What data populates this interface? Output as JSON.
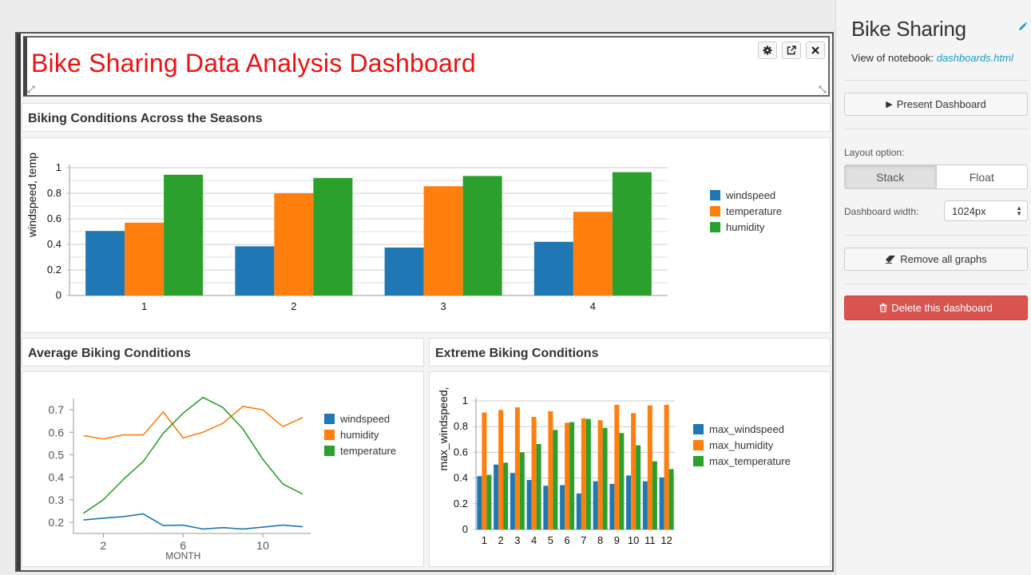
{
  "dashboard": {
    "title": "Bike Sharing Data Analysis Dashboard",
    "title_color": "#ee1111"
  },
  "panels": {
    "seasons_title": "Biking Conditions Across the Seasons",
    "average_title": "Average Biking Conditions",
    "extreme_title": "Extreme Biking Conditions"
  },
  "cell_buttons": {
    "settings_icon": "gear-icon",
    "popout_icon": "external-link-icon",
    "close_icon": "close-icon"
  },
  "sidebar": {
    "title": "Bike Sharing",
    "notebook_label": "View of notebook:",
    "notebook_link": "dashboards.html",
    "present_label": "Present Dashboard",
    "layout_label": "Layout option:",
    "layout_options": [
      "Stack",
      "Float"
    ],
    "layout_selected": "Stack",
    "width_label": "Dashboard width:",
    "width_value": "1024px",
    "remove_label": "Remove all graphs",
    "delete_label": "Delete this dashboard",
    "delete_color": "#d9534f",
    "link_color": "#1aa0c8"
  },
  "chart_data": [
    {
      "type": "bar",
      "categories": [
        "1",
        "2",
        "3",
        "4"
      ],
      "ylabel": "windspeed, temp",
      "ylim": [
        0,
        1
      ],
      "yticks": [
        "0",
        "0.2",
        "0.4",
        "0.6",
        "0.8",
        "1"
      ],
      "legend": "right",
      "series": [
        {
          "name": "windspeed",
          "color": "#1f77b4",
          "values": [
            0.505,
            0.385,
            0.375,
            0.42
          ]
        },
        {
          "name": "temperature",
          "color": "#ff7f0e",
          "values": [
            0.57,
            0.8,
            0.855,
            0.655
          ]
        },
        {
          "name": "humidity",
          "color": "#2ca02c",
          "values": [
            0.945,
            0.92,
            0.935,
            0.965
          ]
        }
      ]
    },
    {
      "type": "line",
      "x": [
        1,
        2,
        3,
        4,
        5,
        6,
        7,
        8,
        9,
        10,
        11,
        12
      ],
      "xlabel": "MONTH",
      "xticks": [
        "2",
        "6",
        "10"
      ],
      "ylim": [
        0.15,
        0.75
      ],
      "yticks": [
        "0.2",
        "0.3",
        "0.4",
        "0.5",
        "0.6",
        "0.7"
      ],
      "legend": "right",
      "series": [
        {
          "name": "windspeed",
          "color": "#1f77b4",
          "values": [
            0.21,
            0.218,
            0.225,
            0.237,
            0.185,
            0.187,
            0.17,
            0.176,
            0.17,
            0.178,
            0.187,
            0.18
          ]
        },
        {
          "name": "humidity",
          "color": "#ff7f0e",
          "values": [
            0.585,
            0.57,
            0.588,
            0.588,
            0.69,
            0.575,
            0.6,
            0.64,
            0.715,
            0.7,
            0.625,
            0.665
          ]
        },
        {
          "name": "temperature",
          "color": "#2ca02c",
          "values": [
            0.24,
            0.3,
            0.39,
            0.47,
            0.595,
            0.685,
            0.755,
            0.71,
            0.615,
            0.48,
            0.37,
            0.325
          ]
        }
      ]
    },
    {
      "type": "bar",
      "categories": [
        "1",
        "2",
        "3",
        "4",
        "5",
        "6",
        "7",
        "8",
        "9",
        "10",
        "11",
        "12"
      ],
      "ylabel": "max_windspeed,",
      "ylim": [
        0,
        1
      ],
      "yticks": [
        "0",
        "0.2",
        "0.4",
        "0.6",
        "0.8",
        "1"
      ],
      "legend": "right",
      "series": [
        {
          "name": "max_windspeed",
          "color": "#1f77b4",
          "values": [
            0.415,
            0.505,
            0.44,
            0.385,
            0.34,
            0.345,
            0.28,
            0.375,
            0.355,
            0.42,
            0.375,
            0.405
          ]
        },
        {
          "name": "max_humidity",
          "color": "#ff7f0e",
          "values": [
            0.91,
            0.93,
            0.95,
            0.875,
            0.92,
            0.83,
            0.865,
            0.85,
            0.97,
            0.905,
            0.965,
            0.97
          ]
        },
        {
          "name": "max_temperature",
          "color": "#2ca02c",
          "values": [
            0.425,
            0.52,
            0.6,
            0.665,
            0.775,
            0.835,
            0.86,
            0.79,
            0.75,
            0.655,
            0.53,
            0.47
          ]
        }
      ]
    }
  ]
}
